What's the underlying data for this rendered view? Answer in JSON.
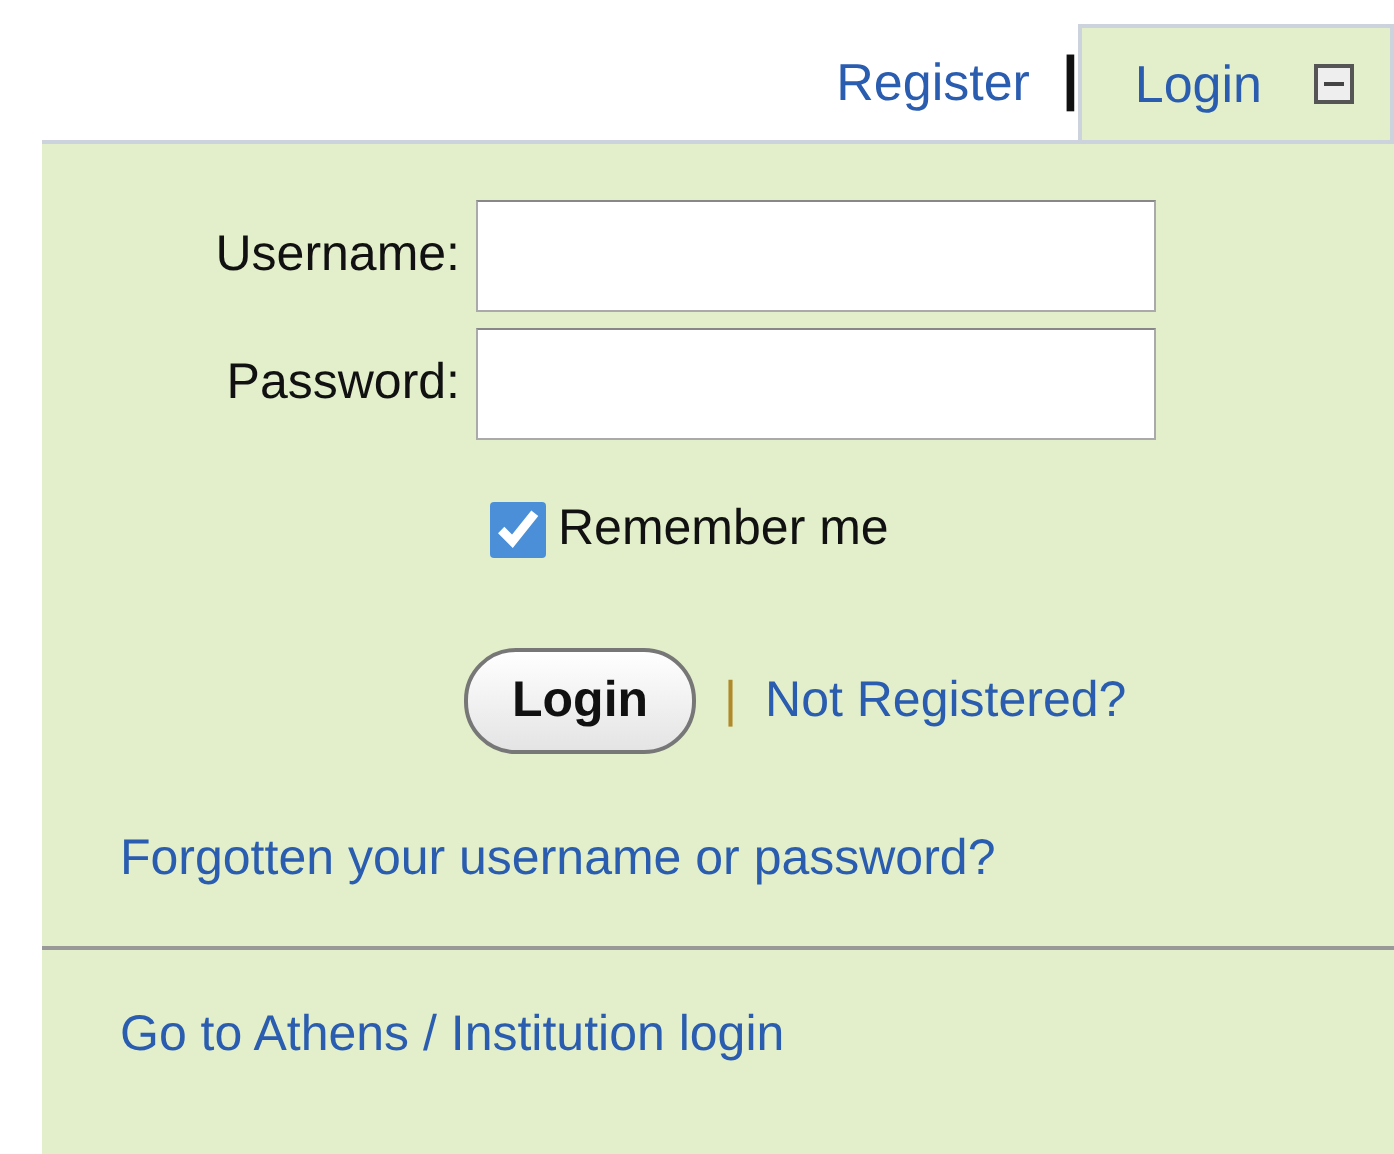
{
  "tabs": [
    {
      "label": "Register",
      "selected": false
    },
    {
      "label": "Login",
      "selected": true
    }
  ],
  "tab_separator": "|",
  "form": {
    "fields": [
      {
        "label": "Username:"
      },
      {
        "label": "Password:"
      }
    ],
    "remember": {
      "label": "Remember me",
      "checked": true
    },
    "submit": "Login",
    "link_separator": "|",
    "register_link": "Not Registered?",
    "forgot_link": "Forgotten your username or password?"
  },
  "footer_link": "Go to Athens / Institution login"
}
